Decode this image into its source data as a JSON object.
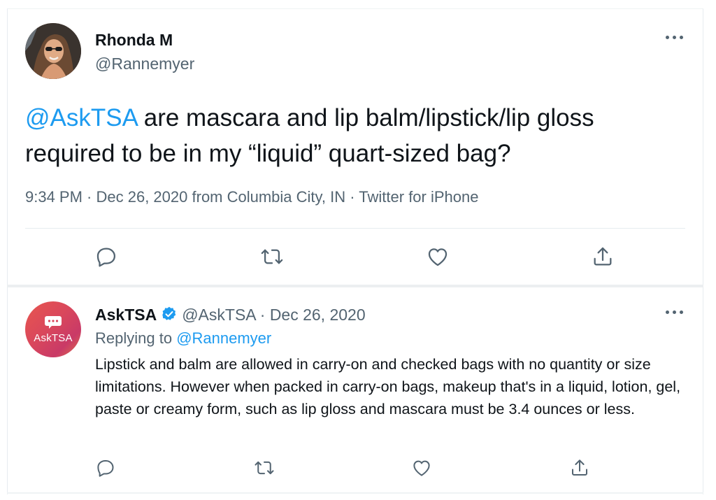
{
  "main_tweet": {
    "author_name": "Rhonda M",
    "author_handle": "@Rannemyer",
    "mention": "@AskTSA",
    "text": " are mascara and lip balm/lipstick/lip gloss required to be in my “liquid” quart-sized bag?",
    "time": "9:34 PM",
    "date": "Dec 26, 2020",
    "location": "from Columbia City, IN",
    "client": "Twitter for iPhone",
    "separator": " · ",
    "more_icon": "more-horizontal-icon",
    "actions": [
      "reply-icon",
      "retweet-icon",
      "like-icon",
      "share-icon"
    ]
  },
  "reply_tweet": {
    "author_name": "AskTSA",
    "verified_icon": "verified-badge-icon",
    "author_handle": "@AskTSA",
    "separator": " · ",
    "date": "Dec 26, 2020",
    "replying_label": "Replying to ",
    "replying_to": "@Rannemyer",
    "avatar_text": "AskTSA",
    "text": "Lipstick and balm are allowed in carry-on and checked bags with no quantity or size limitations. However when packed in carry-on bags, makeup that's in a liquid, lotion, gel, paste or creamy form, such as lip gloss and mascara must be 3.4 ounces or less.",
    "more_icon": "more-horizontal-icon",
    "actions": [
      "reply-icon",
      "retweet-icon",
      "like-icon",
      "share-icon"
    ]
  },
  "colors": {
    "link": "#1d9bf0",
    "secondary": "#536471",
    "primary_text": "#0f1419",
    "divider": "#e6ecf0"
  }
}
